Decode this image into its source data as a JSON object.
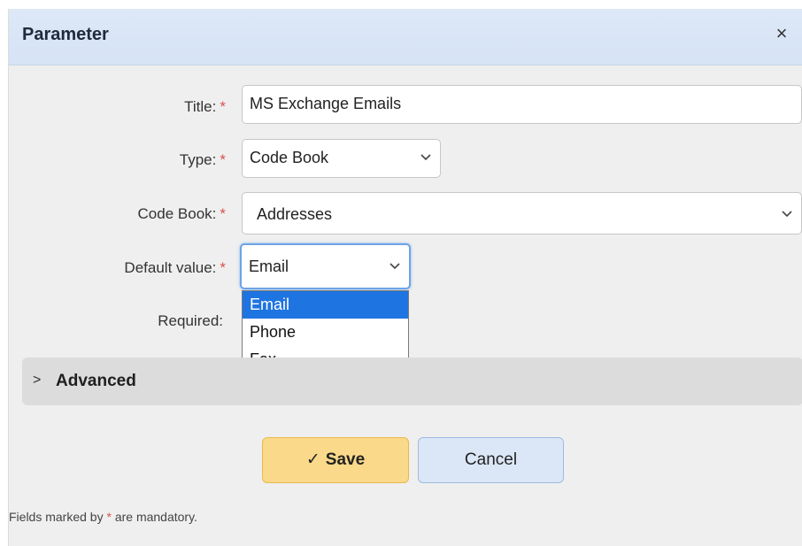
{
  "dialog": {
    "title": "Parameter",
    "close_glyph": "×"
  },
  "form": {
    "title_label": "Title:",
    "title_value": "MS Exchange Emails",
    "type_label": "Type:",
    "type_value": "Code Book",
    "codebook_label": "Code Book:",
    "codebook_value": "Addresses",
    "default_label": "Default value:",
    "default_value": "Email",
    "required_label": "Required:",
    "required_mark": "*"
  },
  "default_options": [
    "Email",
    "Phone",
    "Fax"
  ],
  "selected_option_index": 0,
  "advanced": {
    "label": "Advanced",
    "arrow": ">"
  },
  "buttons": {
    "save_check": "✓",
    "save": "Save",
    "cancel": "Cancel"
  },
  "footnote": {
    "pre": "Fields marked by ",
    "mark": "*",
    "post": " are mandatory."
  },
  "colors": {
    "header_bg": "#d6e3f5",
    "save_bg": "#fbd98a",
    "cancel_bg": "#dbe7f7",
    "selected_option_bg": "#1e74e0",
    "required_mark": "#d9534f"
  }
}
